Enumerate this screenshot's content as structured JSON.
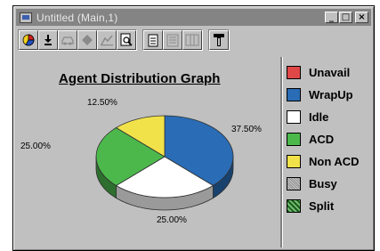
{
  "window": {
    "title": "Untitled  (Main,1)",
    "controls": {
      "minimize": "_",
      "maximize": "□",
      "close": "×"
    }
  },
  "toolbar": {
    "buttons": [
      {
        "icon": "pie-chart-icon",
        "enabled": true
      },
      {
        "icon": "export-icon",
        "enabled": true
      },
      {
        "icon": "car-icon",
        "enabled": false
      },
      {
        "icon": "diamond-icon",
        "enabled": false
      },
      {
        "icon": "scatter-chart-icon",
        "enabled": false
      },
      {
        "icon": "print-preview-icon",
        "enabled": true
      },
      {
        "icon": "document-icon",
        "enabled": true
      },
      {
        "icon": "document-list-icon",
        "enabled": false
      },
      {
        "icon": "table-icon",
        "enabled": false
      },
      {
        "icon": "paint-brush-icon",
        "enabled": true
      }
    ]
  },
  "chart_data": {
    "type": "pie",
    "title": "Agent Distribution Graph",
    "three_d": true,
    "slices": [
      {
        "name": "WrapUp",
        "value": 37.5,
        "label": "37.50%",
        "color": "#2a6cb5"
      },
      {
        "name": "Idle",
        "value": 25.0,
        "label": "25.00%",
        "color": "#ffffff"
      },
      {
        "name": "ACD",
        "value": 25.0,
        "label": "25.00%",
        "color": "#4cb84c"
      },
      {
        "name": "Non ACD",
        "value": 12.5,
        "label": "12.50%",
        "color": "#f2e24a"
      }
    ],
    "legend": [
      {
        "label": "Unavail",
        "color": "#e04848"
      },
      {
        "label": "WrapUp",
        "color": "#2a6cb5"
      },
      {
        "label": "Idle",
        "color": "#ffffff"
      },
      {
        "label": "ACD",
        "color": "#4cb84c"
      },
      {
        "label": "Non ACD",
        "color": "#f2e24a"
      },
      {
        "label": "Busy",
        "color": "#a0a0a0"
      },
      {
        "label": "Split",
        "color": "#2e7a2e"
      }
    ],
    "legend_position": "right"
  }
}
